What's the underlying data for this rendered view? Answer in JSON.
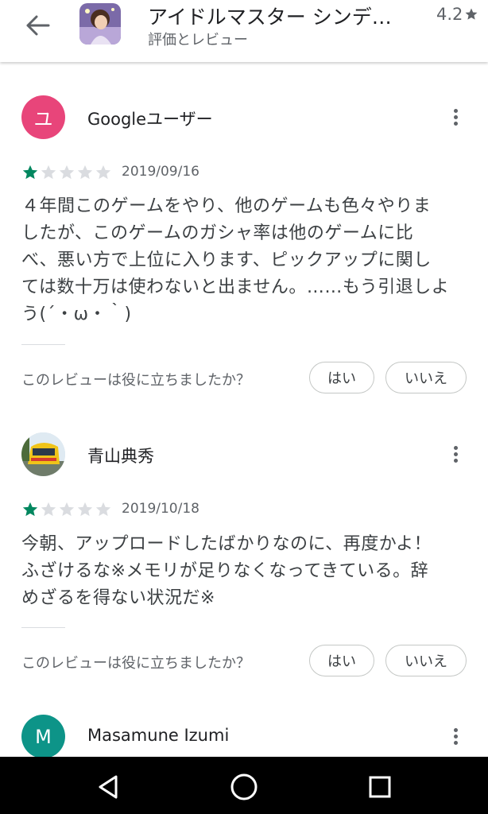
{
  "header": {
    "app_title": "アイドルマスター シンデ…",
    "subtitle": "評価とレビュー",
    "rating": "4.2"
  },
  "colors": {
    "star_filled": "#01875f",
    "star_empty": "#dadce0",
    "avatar_pink": "#e8457a",
    "avatar_teal": "#0d9488"
  },
  "reviews": [
    {
      "author": "Googleユーザー",
      "avatar_letter": "ユ",
      "stars": 1,
      "date": "2019/09/16",
      "lines": [
        "４年間このゲームをやり、他のゲームも色々やりま",
        "したが、このゲームのガシャ率は他のゲームに比",
        "べ、悪い方で上位に入ります、ピックアップに関し",
        "ては数十万は使わないと出ません。……もう引退しよ",
        "う(´・ω・｀)"
      ],
      "helpful_question": "このレビューは役に立ちましたか？",
      "yes_label": "はい",
      "no_label": "いいえ"
    },
    {
      "author": "青山典秀",
      "stars": 1,
      "date": "2019/10/18",
      "lines": [
        "今朝、アップロードしたばかりなのに、再度かよ！",
        "ふざけるな※メモリが足りなくなってきている。辞",
        "めざるを得ない状況だ※"
      ],
      "helpful_question": "このレビューは役に立ちましたか？",
      "yes_label": "はい",
      "no_label": "いいえ"
    },
    {
      "author": "Masamune Izumi",
      "avatar_letter": "M"
    }
  ]
}
